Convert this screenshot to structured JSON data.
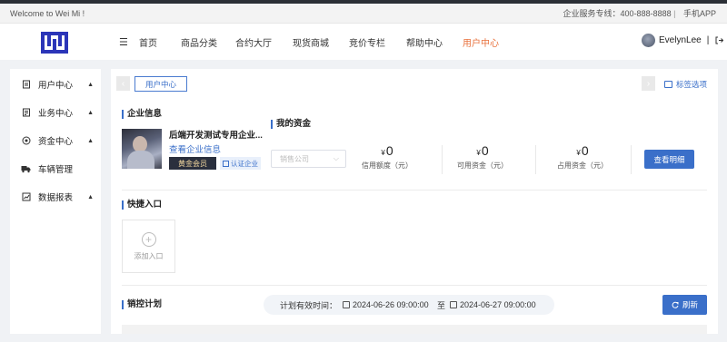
{
  "topbar": {
    "welcome": "Welcome to Wei Mi !",
    "hotline": "企业服务专线：400-888-8888",
    "separator": "|",
    "app": "手机APP"
  },
  "nav": {
    "menu_icon": "menu-icon",
    "items": [
      "首页",
      "商品分类",
      "合约大厅",
      "现货商城",
      "竞价专栏",
      "帮助中心",
      "用户中心"
    ],
    "active_index": 6,
    "active_color": "#e8713c",
    "username": "EvelynLee",
    "user_sep": "|"
  },
  "sidebar": {
    "items": [
      {
        "label": "用户中心",
        "icon": "user-doc-icon",
        "arrow": "▲"
      },
      {
        "label": "业务中心",
        "icon": "business-icon",
        "arrow": "▲"
      },
      {
        "label": "资金中心",
        "icon": "funds-icon",
        "arrow": "▲"
      },
      {
        "label": "车辆管理",
        "icon": "truck-icon",
        "arrow": ""
      },
      {
        "label": "数据报表",
        "icon": "chart-icon",
        "arrow": "▲"
      }
    ]
  },
  "tabs": {
    "prev": "‹",
    "next": "›",
    "current": "用户中心",
    "options": "标签选项"
  },
  "company": {
    "section_title": "企业信息",
    "name": "后端开发测试专用企业...",
    "link": "查看企业信息",
    "member_badge": "黄金会员",
    "cert_badge": "认证企业"
  },
  "funds": {
    "section_title": "我的资金",
    "select_placeholder": "销售公司",
    "currency": "¥",
    "items": [
      {
        "value": "0",
        "label": "信用额度（元）"
      },
      {
        "value": "0",
        "label": "可用资金（元）"
      },
      {
        "value": "0",
        "label": "占用资金（元）"
      }
    ],
    "detail_button": "查看明细"
  },
  "quick": {
    "section_title": "快捷入口",
    "add_label": "添加入口"
  },
  "plan": {
    "section_title": "销控计划",
    "period_label": "计划有效时间：",
    "start": "2024-06-26 09:00:00",
    "to": "至",
    "end": "2024-06-27 09:00:00",
    "refresh": "刷新"
  },
  "colors": {
    "accent": "#3a6fc9",
    "brand_logo": "#2b35b8",
    "gold_badge_bg": "#2a2f3d"
  }
}
